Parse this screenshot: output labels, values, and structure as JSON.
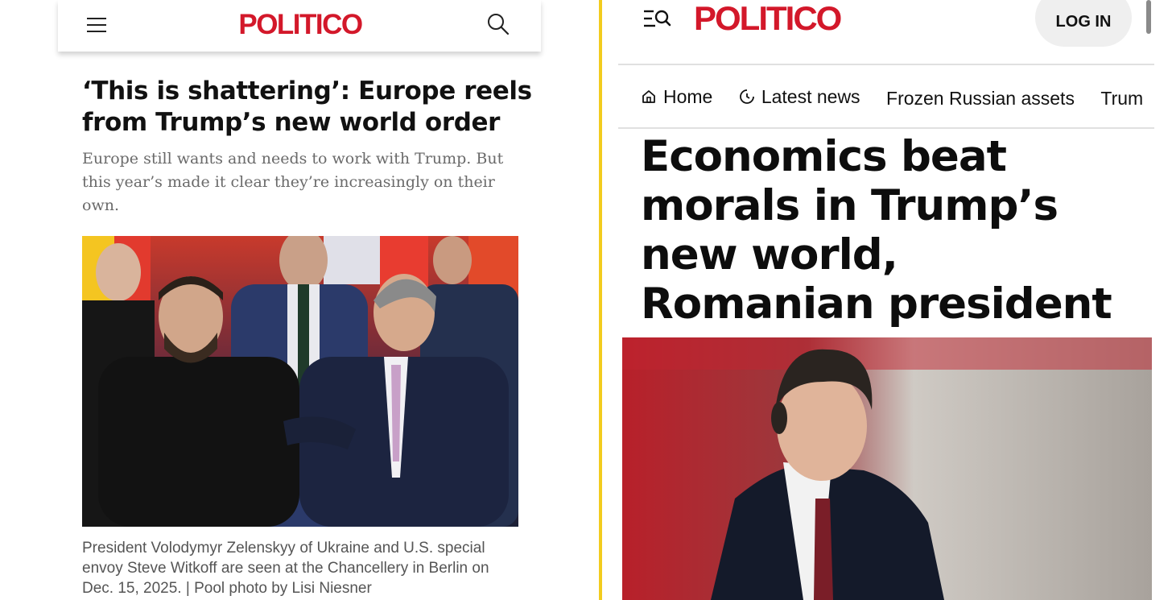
{
  "left": {
    "header": {
      "logo": "POLITICO",
      "menu_icon": "hamburger-menu-icon",
      "search_icon": "search-icon"
    },
    "article": {
      "headline": "‘This is shattering’: Europe reels from Trump’s new world order",
      "dek": "Europe still wants and needs to work with Trump. But this year’s made it clear they’re increasingly on their own.",
      "caption": "President Volodymyr Zelenskyy of Ukraine and U.S. special envoy Steve Witkoff are seen at the Chancellery in Berlin on Dec. 15, 2025. | Pool photo by Lisi Niesner"
    }
  },
  "right": {
    "header": {
      "logo": "POLITICO",
      "menu_icon": "menu-search-icon",
      "login_label": "LOG IN"
    },
    "nav": [
      {
        "label": "Home",
        "icon": "home-icon"
      },
      {
        "label": "Latest news",
        "icon": "clock-icon"
      },
      {
        "label": "Frozen Russian assets",
        "icon": ""
      },
      {
        "label": "Trum",
        "icon": ""
      }
    ],
    "article": {
      "headline": "Economics beat morals in Trump’s new world, Romanian president says"
    }
  },
  "colors": {
    "brand_red": "#d3182a",
    "divider_yellow": "#f2cc1e",
    "dek_gray": "#6a6a6a"
  }
}
